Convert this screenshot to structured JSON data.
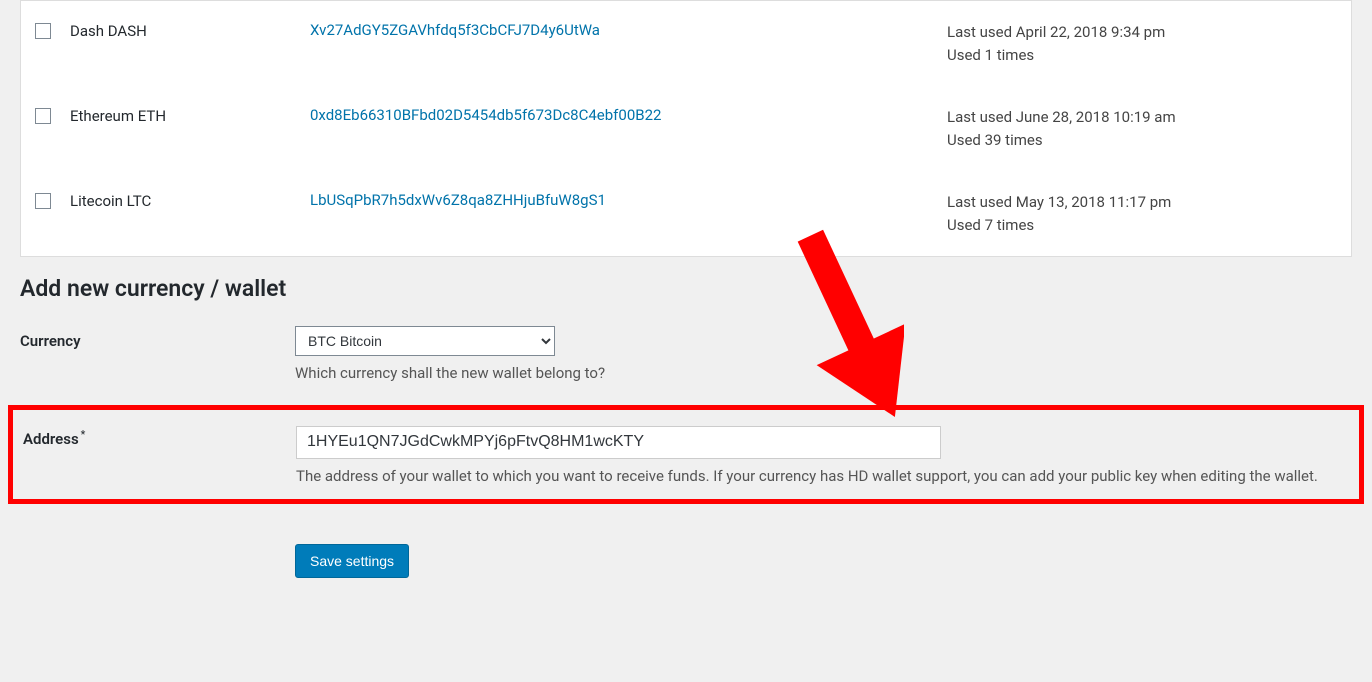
{
  "wallets": [
    {
      "currency": "Dash DASH",
      "address": "Xv27AdGY5ZGAVhfdq5f3CbCFJ7D4y6UtWa",
      "lastUsed": "Last used April 22, 2018 9:34 pm",
      "usedTimes": "Used 1 times"
    },
    {
      "currency": "Ethereum ETH",
      "address": "0xd8Eb66310BFbd02D5454db5f673Dc8C4ebf00B22",
      "lastUsed": "Last used June 28, 2018 10:19 am",
      "usedTimes": "Used 39 times"
    },
    {
      "currency": "Litecoin LTC",
      "address": "LbUSqPbR7h5dxWv6Z8qa8ZHHjuBfuW8gS1",
      "lastUsed": "Last used May 13, 2018 11:17 pm",
      "usedTimes": "Used 7 times"
    }
  ],
  "form": {
    "sectionHeading": "Add new currency / wallet",
    "currencyLabel": "Currency",
    "currencySelected": "BTC Bitcoin",
    "currencyHelp": "Which currency shall the new wallet belong to?",
    "addressLabel": "Address",
    "addressRequired": "*",
    "addressValue": "1HYEu1QN7JGdCwkMPYj6pFtvQ8HM1wcKTY",
    "addressHelp": "The address of your wallet to which you want to receive funds. If your currency has HD wallet support, you can add your public key when editing the wallet.",
    "saveButton": "Save settings"
  }
}
